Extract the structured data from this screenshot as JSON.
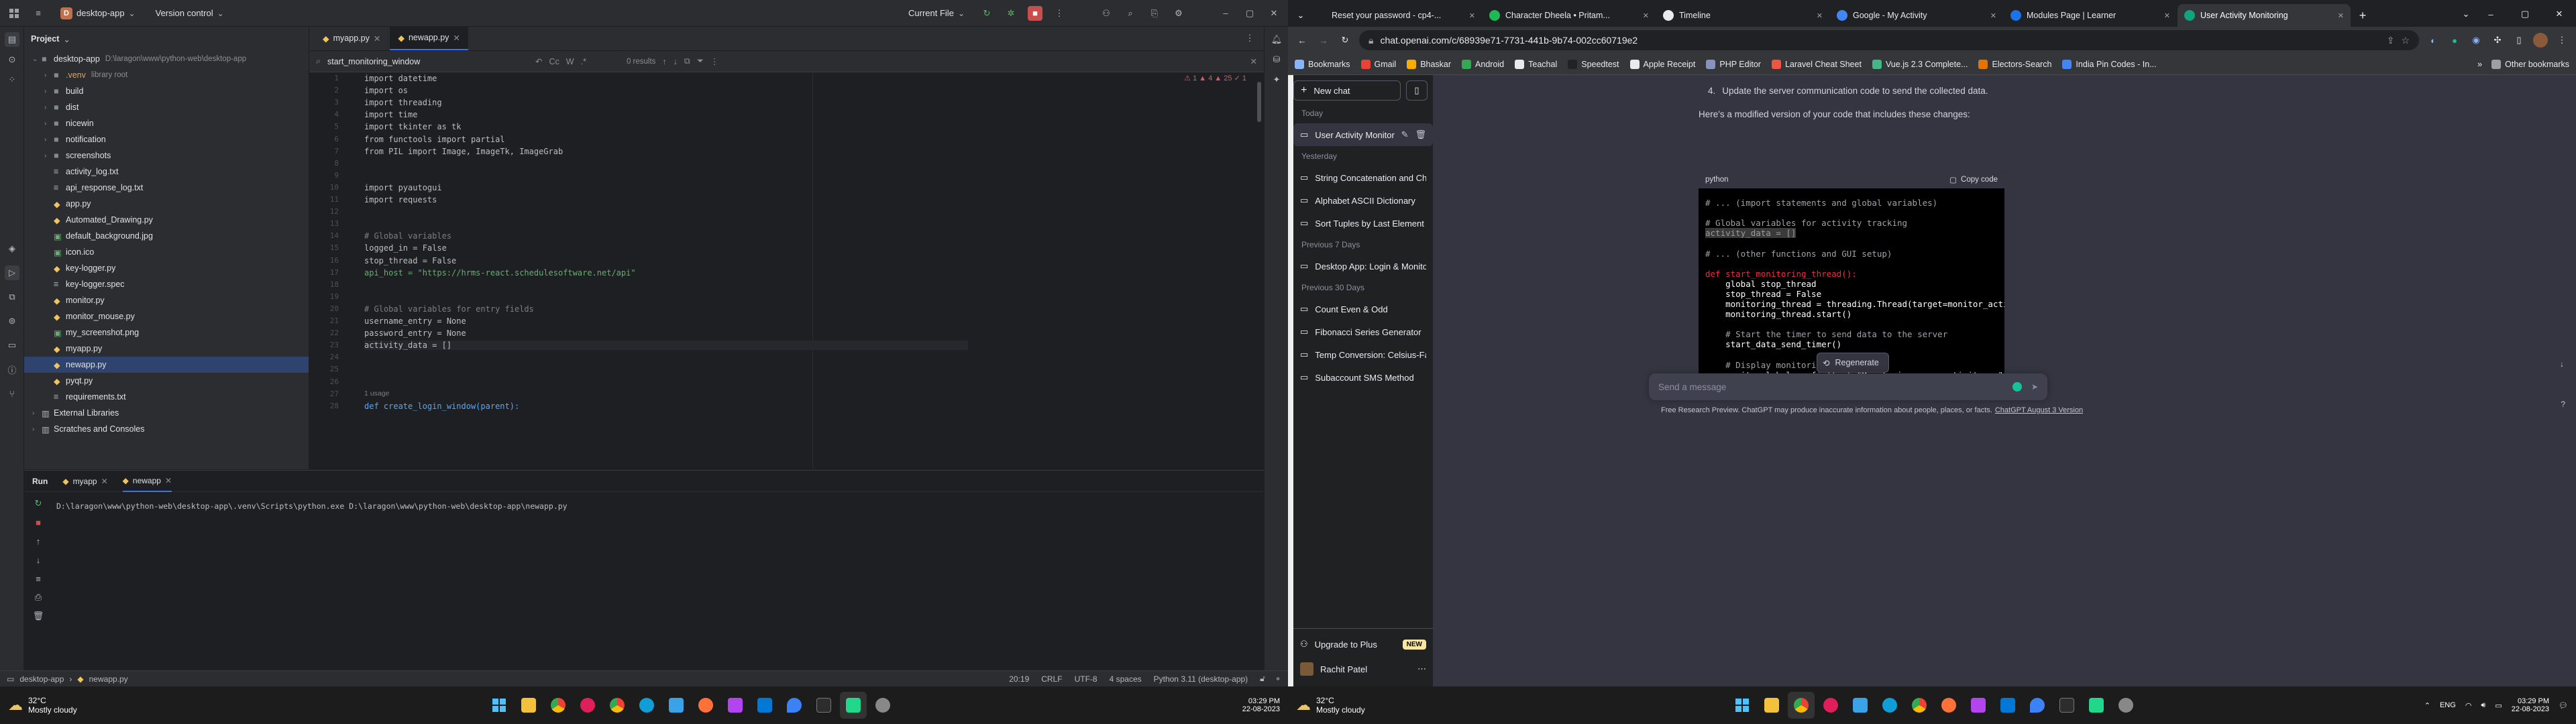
{
  "ide": {
    "project_name": "desktop-app",
    "project_badge": "D",
    "vcs": "Version control",
    "run_config": "Current File",
    "tabs": [
      {
        "label": "myapp.py"
      },
      {
        "label": "newapp.py"
      }
    ],
    "find": {
      "query": "start_monitoring_window",
      "results": "0 results"
    },
    "project_title": "Project",
    "tree": [
      {
        "label": "desktop-app",
        "extra": "D:\\laragon\\www\\python-web\\desktop-app",
        "kind": "folder",
        "indent": 0,
        "expanded": true
      },
      {
        "label": ".venv",
        "extra": "library root",
        "kind": "folder",
        "indent": 1
      },
      {
        "label": "build",
        "kind": "folder",
        "indent": 1
      },
      {
        "label": "dist",
        "kind": "folder",
        "indent": 1
      },
      {
        "label": "nicewin",
        "kind": "folder",
        "indent": 1
      },
      {
        "label": "notification",
        "kind": "folder",
        "indent": 1
      },
      {
        "label": "screenshots",
        "kind": "folder",
        "indent": 1
      },
      {
        "label": "activity_log.txt",
        "kind": "txt",
        "indent": 1
      },
      {
        "label": "api_response_log.txt",
        "kind": "txt",
        "indent": 1
      },
      {
        "label": "app.py",
        "kind": "py",
        "indent": 1
      },
      {
        "label": "Automated_Drawing.py",
        "kind": "py",
        "indent": 1
      },
      {
        "label": "default_background.jpg",
        "kind": "img",
        "indent": 1
      },
      {
        "label": "icon.ico",
        "kind": "img",
        "indent": 1
      },
      {
        "label": "key-logger.py",
        "kind": "py",
        "indent": 1
      },
      {
        "label": "key-logger.spec",
        "kind": "txt",
        "indent": 1
      },
      {
        "label": "monitor.py",
        "kind": "py",
        "indent": 1
      },
      {
        "label": "monitor_mouse.py",
        "kind": "py",
        "indent": 1
      },
      {
        "label": "my_screenshot.png",
        "kind": "img",
        "indent": 1
      },
      {
        "label": "myapp.py",
        "kind": "py",
        "indent": 1
      },
      {
        "label": "newapp.py",
        "kind": "py",
        "indent": 1,
        "selected": true
      },
      {
        "label": "pyqt.py",
        "kind": "py",
        "indent": 1
      },
      {
        "label": "requirements.txt",
        "kind": "txt",
        "indent": 1
      },
      {
        "label": "External Libraries",
        "kind": "lib",
        "indent": 0
      },
      {
        "label": "Scratches and Consoles",
        "kind": "lib",
        "indent": 0
      }
    ],
    "inspections": "⚠ 1  ▲ 4  ▲ 25  ✓ 1",
    "code_lines": [
      {
        "n": "1",
        "t": "import datetime"
      },
      {
        "n": "2",
        "t": "import os"
      },
      {
        "n": "3",
        "t": "import threading"
      },
      {
        "n": "4",
        "t": "import time"
      },
      {
        "n": "5",
        "t": "import tkinter as tk"
      },
      {
        "n": "6",
        "t": "from functools import partial"
      },
      {
        "n": "7",
        "t": "from PIL import Image, ImageTk, ImageGrab"
      },
      {
        "n": "8",
        "t": ""
      },
      {
        "n": "9",
        "t": ""
      },
      {
        "n": "10",
        "t": "import pyautogui"
      },
      {
        "n": "11",
        "t": "import requests"
      },
      {
        "n": "12",
        "t": ""
      },
      {
        "n": "13",
        "t": ""
      },
      {
        "n": "14",
        "t": "# Global variables"
      },
      {
        "n": "15",
        "t": "logged_in = False"
      },
      {
        "n": "16",
        "t": "stop_thread = False"
      },
      {
        "n": "17",
        "t": "api_host = \"https://hrms-react.schedulesoftware.net/api\""
      },
      {
        "n": "18",
        "t": ""
      },
      {
        "n": "19",
        "t": ""
      },
      {
        "n": "20",
        "t": "# Global variables for entry fields"
      },
      {
        "n": "21",
        "t": "username_entry = None"
      },
      {
        "n": "22",
        "t": "password_entry = None"
      },
      {
        "n": "23",
        "t": "activity_data = []"
      },
      {
        "n": "24",
        "t": ""
      },
      {
        "n": "25",
        "t": ""
      },
      {
        "n": "26",
        "t": ""
      },
      {
        "n": "27",
        "t": "1 usage"
      },
      {
        "n": "28",
        "t": "def create_login_window(parent):"
      }
    ],
    "run": {
      "title": "Run",
      "tabs": [
        "myapp",
        "newapp"
      ],
      "command": "D:\\laragon\\www\\python-web\\desktop-app\\.venv\\Scripts\\python.exe D:\\laragon\\www\\python-web\\desktop-app\\newapp.py"
    },
    "status": {
      "crumb1": "desktop-app",
      "crumb2": "newapp.py",
      "pos": "20:19",
      "eol": "CRLF",
      "enc": "UTF-8",
      "indent": "4 spaces",
      "interp": "Python 3.11 (desktop-app)"
    }
  },
  "taskbar_left": {
    "temp": "32°C",
    "weather": "Mostly cloudy",
    "time": "03:29 PM",
    "date": "22-08-2023"
  },
  "browser": {
    "tabs": [
      {
        "label": "Reset your password - cp4-...",
        "fav": "#202123"
      },
      {
        "label": "Character Dheela • Pritam...",
        "fav": "#1db954"
      },
      {
        "label": "Timeline",
        "fav": "#e8eaed"
      },
      {
        "label": "Google - My Activity",
        "fav": "#4285f4"
      },
      {
        "label": "Modules Page | Learner",
        "fav": "#1a73e8"
      },
      {
        "label": "User Activity Monitoring",
        "fav": "#10a37f",
        "active": true
      }
    ],
    "url": "chat.openai.com/c/68939e71-7731-441b-9b74-002cc60719e2",
    "bookmarks": [
      {
        "label": "Bookmarks",
        "c": "#8ab4f8"
      },
      {
        "label": "Gmail",
        "c": "#ea4335"
      },
      {
        "label": "Bhaskar",
        "c": "#f9ab00"
      },
      {
        "label": "Android",
        "c": "#34a853"
      },
      {
        "label": "Teachal",
        "c": "#e8eaed"
      },
      {
        "label": "Speedtest",
        "c": "#222"
      },
      {
        "label": "Apple Receipt",
        "c": "#e8eaed"
      },
      {
        "label": "PHP Editor",
        "c": "#8892bf"
      },
      {
        "label": "Laravel Cheat Sheet",
        "c": "#f05340"
      },
      {
        "label": "Vue.js 2.3 Complete...",
        "c": "#41b883"
      },
      {
        "label": "Electors-Search",
        "c": "#e37400"
      },
      {
        "label": "India Pin Codes - In...",
        "c": "#4285f4"
      }
    ],
    "other_bookmarks": "Other bookmarks"
  },
  "chatgpt": {
    "new_chat": "New chat",
    "sections": [
      {
        "head": "Today",
        "items": [
          "User Activity Monitoring"
        ]
      },
      {
        "head": "Yesterday",
        "items": [
          "String Concatenation and Che",
          "Alphabet ASCII Dictionary",
          "Sort Tuples by Last Element"
        ]
      },
      {
        "head": "Previous 7 Days",
        "items": [
          "Desktop App: Login & Monitor"
        ]
      },
      {
        "head": "Previous 30 Days",
        "items": [
          "Count Even & Odd",
          "Fibonacci Series Generator",
          "Temp Conversion: Celsius-Fah",
          "Subaccount SMS Method"
        ]
      }
    ],
    "upgrade": "Upgrade to Plus",
    "new_badge": "NEW",
    "user": "Rachit Patel",
    "step_num": "4.",
    "step_text": "Update the server communication code to send the collected data.",
    "intro": "Here's a modified version of your code that includes these changes:",
    "code_lang": "python",
    "copy": "Copy code",
    "code": [
      {
        "t": "# ... (import statements and global variables)",
        "c": "cm"
      },
      {
        "t": "",
        "c": ""
      },
      {
        "t": "# Global variables for activity tracking",
        "c": "cm"
      },
      {
        "t": "activity_data = []",
        "c": "hl"
      },
      {
        "t": "",
        "c": ""
      },
      {
        "t": "# ... (other functions and GUI setup)",
        "c": "cm"
      },
      {
        "t": "",
        "c": ""
      },
      {
        "t": "def start_monitoring_thread():",
        "c": "def"
      },
      {
        "t": "    global stop_thread",
        "c": "glob"
      },
      {
        "t": "    stop_thread = False",
        "c": "asg"
      },
      {
        "t": "    monitoring_thread = threading.Thread(target=monitor_activity)",
        "c": ""
      },
      {
        "t": "    monitoring_thread.start()",
        "c": ""
      },
      {
        "t": "",
        "c": ""
      },
      {
        "t": "    # Start the timer to send data to the server",
        "c": "cm"
      },
      {
        "t": "    start_data_send_timer()",
        "c": ""
      },
      {
        "t": "",
        "c": ""
      },
      {
        "t": "    # Display monitoring message",
        "c": "cm"
      },
      {
        "t": "    monitor_label.config(text=\"Monitoring user activity...\")",
        "c": "strl"
      }
    ],
    "regenerate": "Regenerate",
    "placeholder": "Send a message",
    "disclaimer": "Free Research Preview. ChatGPT may produce inaccurate information about people, places, or facts.",
    "version_link": "ChatGPT August 3 Version"
  },
  "taskbar_right": {
    "temp": "32°C",
    "weather": "Mostly cloudy",
    "lang": "ENG",
    "time": "03:29 PM",
    "date": "22-08-2023"
  },
  "colors": {
    "accent": "#3574f0",
    "gpt": "#10a37f",
    "plus": "#fae69e"
  }
}
